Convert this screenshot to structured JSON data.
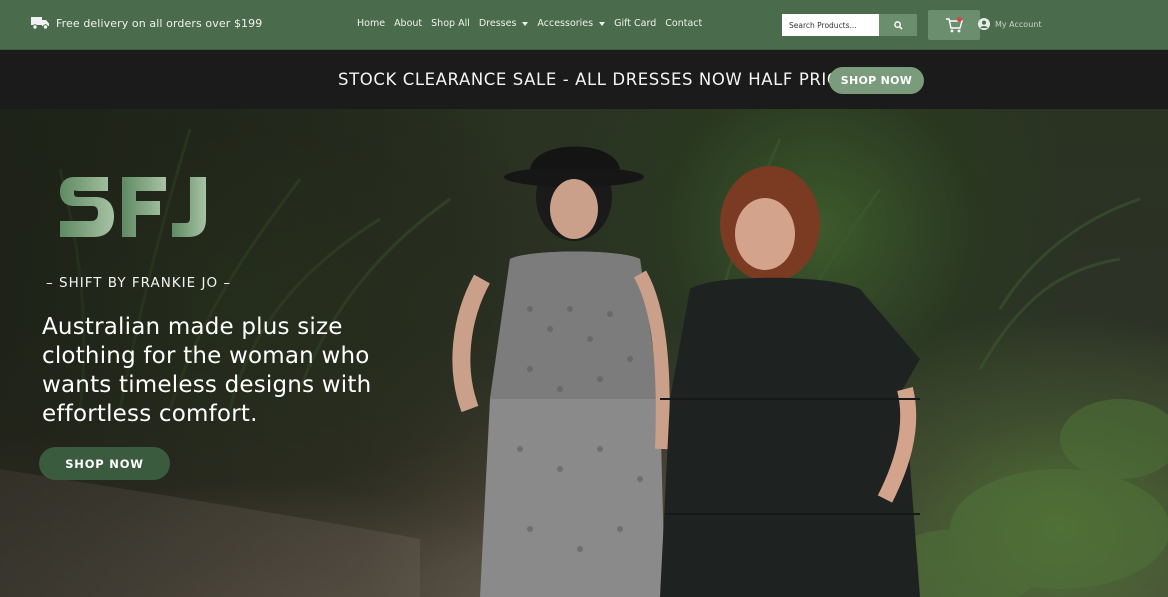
{
  "topbar": {
    "delivery_text": "Free delivery on all orders over $199",
    "nav": [
      {
        "label": "Home",
        "has_dropdown": false
      },
      {
        "label": "About",
        "has_dropdown": false
      },
      {
        "label": "Shop All",
        "has_dropdown": false
      },
      {
        "label": "Dresses",
        "has_dropdown": true
      },
      {
        "label": "Accessories",
        "has_dropdown": true
      },
      {
        "label": "Gift Card",
        "has_dropdown": false
      },
      {
        "label": "Contact",
        "has_dropdown": false
      }
    ],
    "search_placeholder": "Search Products...",
    "account_label": "My Account"
  },
  "announcement": {
    "text": "STOCK CLEARANCE SALE - ALL DRESSES NOW HALF PRICE",
    "button": "SHOP NOW"
  },
  "hero": {
    "logo_text": "SFJ",
    "tagline": "– SHIFT BY FRANKIE JO –",
    "headline": "Australian made plus size clothing for the woman who wants timeless designs with effortless comfort.",
    "button": "SHOP NOW"
  },
  "colors": {
    "topbar_bg": "#4a6b4c",
    "accent_green": "#6b8e6e",
    "announce_bg": "#1b1b1b",
    "hero_button": "#3b5b3f",
    "cart_badge": "#e0404a"
  },
  "icons": [
    "truck-icon",
    "search-icon",
    "cart-icon",
    "account-icon",
    "chevron-down-icon"
  ]
}
